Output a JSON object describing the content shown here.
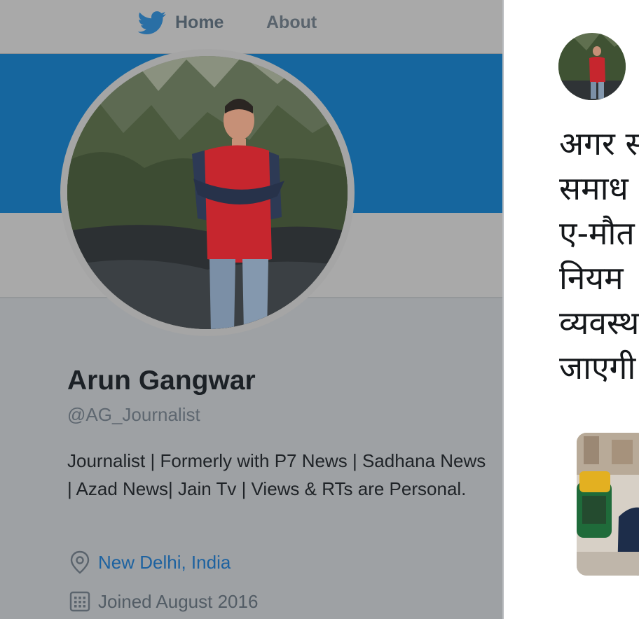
{
  "nav": {
    "logo_icon": "twitter-bird-icon",
    "home_label": "Home",
    "about_label": "About"
  },
  "profile": {
    "name": "Arun Gangwar",
    "handle": "@AG_Journalist",
    "bio": "Journalist | Formerly with P7 News | Sadhana News | Azad News| Jain Tv | Views & RTs are Personal.",
    "location": "New Delhi, India",
    "location_icon": "location-pin-icon",
    "joined": "Joined August 2016",
    "joined_icon": "calendar-icon"
  },
  "tweet": {
    "lines": [
      "अगर स",
      "समाध",
      "ए-मौत",
      "नियम",
      "व्यवस्थ",
      "जाएगी"
    ]
  },
  "colors": {
    "banner": "#16669e",
    "link": "#1d62a0",
    "panel_overlay": "#9ea1a4"
  }
}
